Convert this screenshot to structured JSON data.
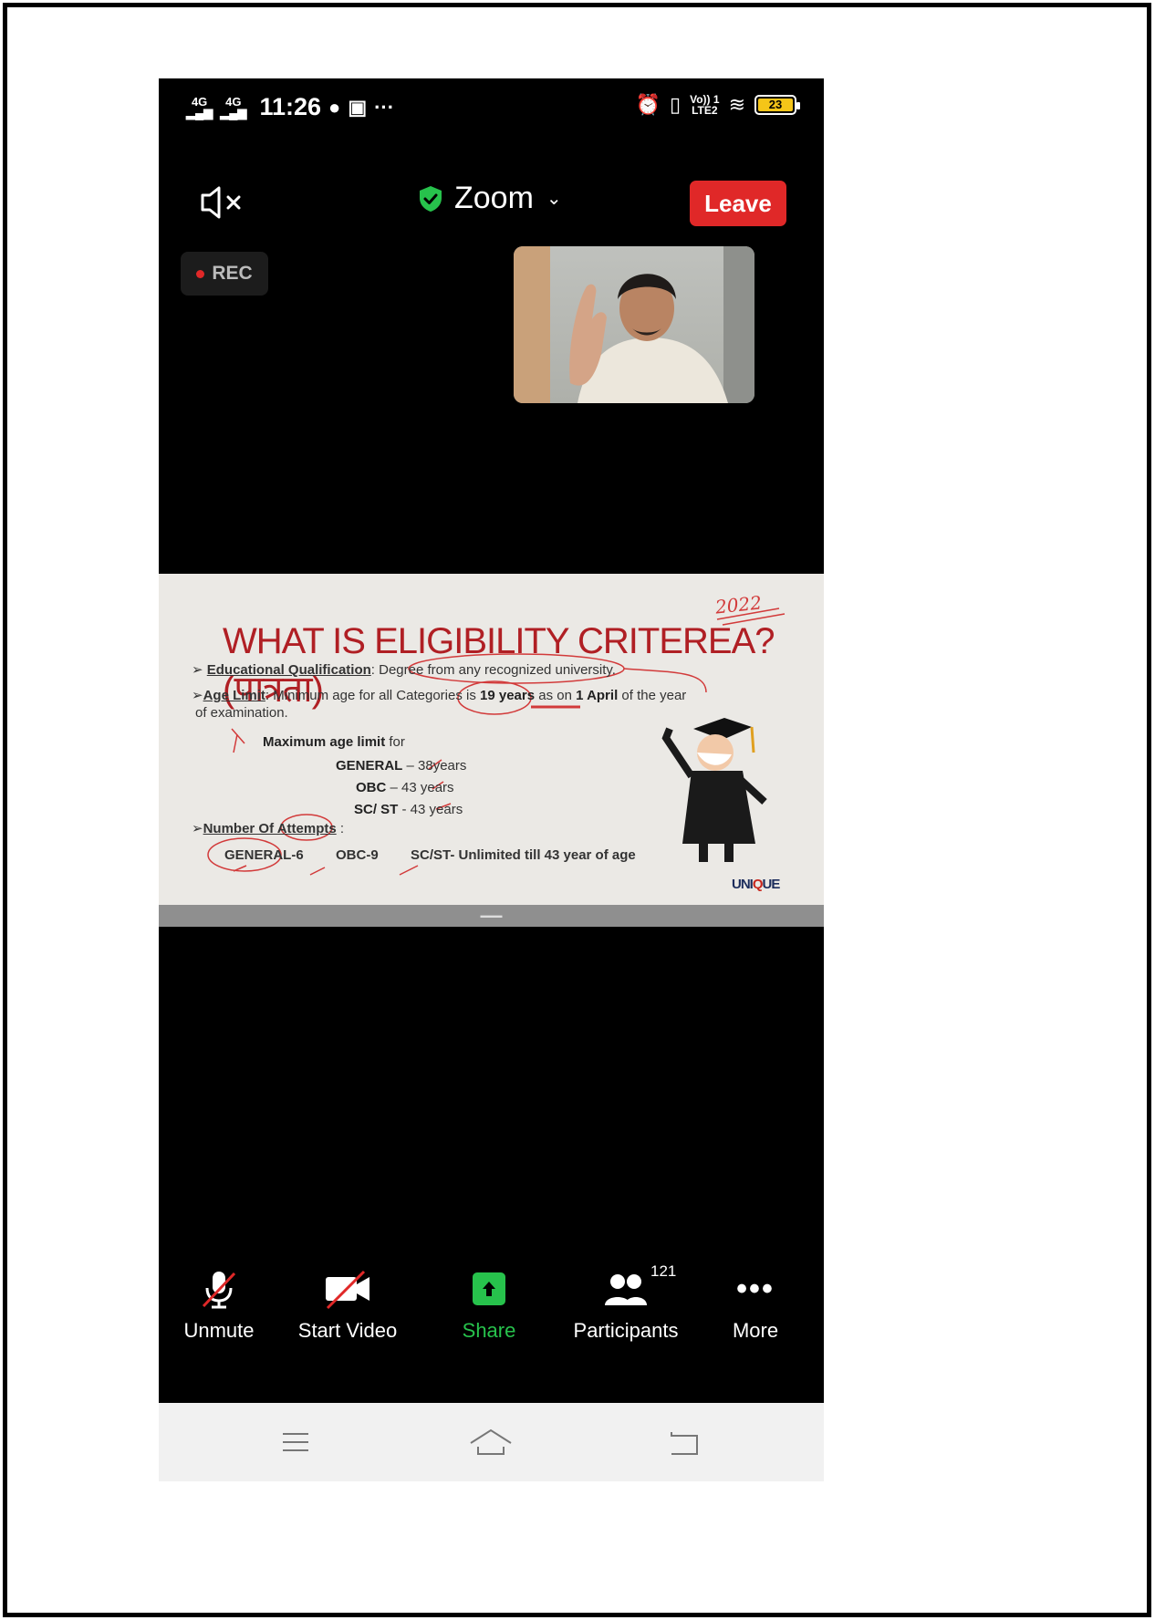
{
  "status_bar": {
    "signal1": "4G",
    "signal2": "4G",
    "time": "11:26",
    "more": "···",
    "lte_top": "Vo)) 1",
    "lte_bottom": "LTE2",
    "battery": "23"
  },
  "header": {
    "title": "Zoom",
    "leave_label": "Leave",
    "rec_label": "REC",
    "accent": "#e02828",
    "secure": "#27c24c"
  },
  "slide": {
    "year_note": "2022",
    "title": "WHAT IS ELIGIBILITY CRITEREA? (पात्रता)",
    "edu_label": "Educational Qualification",
    "edu_value": ": Degree from any recognized university.",
    "age_label": "Age Limit",
    "age_text_1": ":  Minimum age for all Categories is ",
    "age_years": "19 years",
    "age_text_2": " as on ",
    "age_date": "1 April",
    "age_text_3": " of the year",
    "age_text_4": "of examination.",
    "max_label": "Maximum age limit",
    "max_for": " for",
    "general_label": "GENERAL",
    "general_value": " – 38years",
    "obc_label": "OBC",
    "obc_value": " – 43 years",
    "scst_label": "SC/ ST",
    "scst_value": " - 43 years",
    "attempts_label": "Number Of Attempts",
    "attempts_colon": " :",
    "attempt_general": "GENERAL-6",
    "attempt_obc": "OBC-9",
    "attempt_scst": "SC/ST- Unlimited till 43 year of age",
    "logo_1": "UNI",
    "logo_2": "Q",
    "logo_3": "UE"
  },
  "toolbar": {
    "unmute": "Unmute",
    "start_video": "Start Video",
    "share": "Share",
    "participants": "Participants",
    "participants_count": "121",
    "more": "More"
  }
}
